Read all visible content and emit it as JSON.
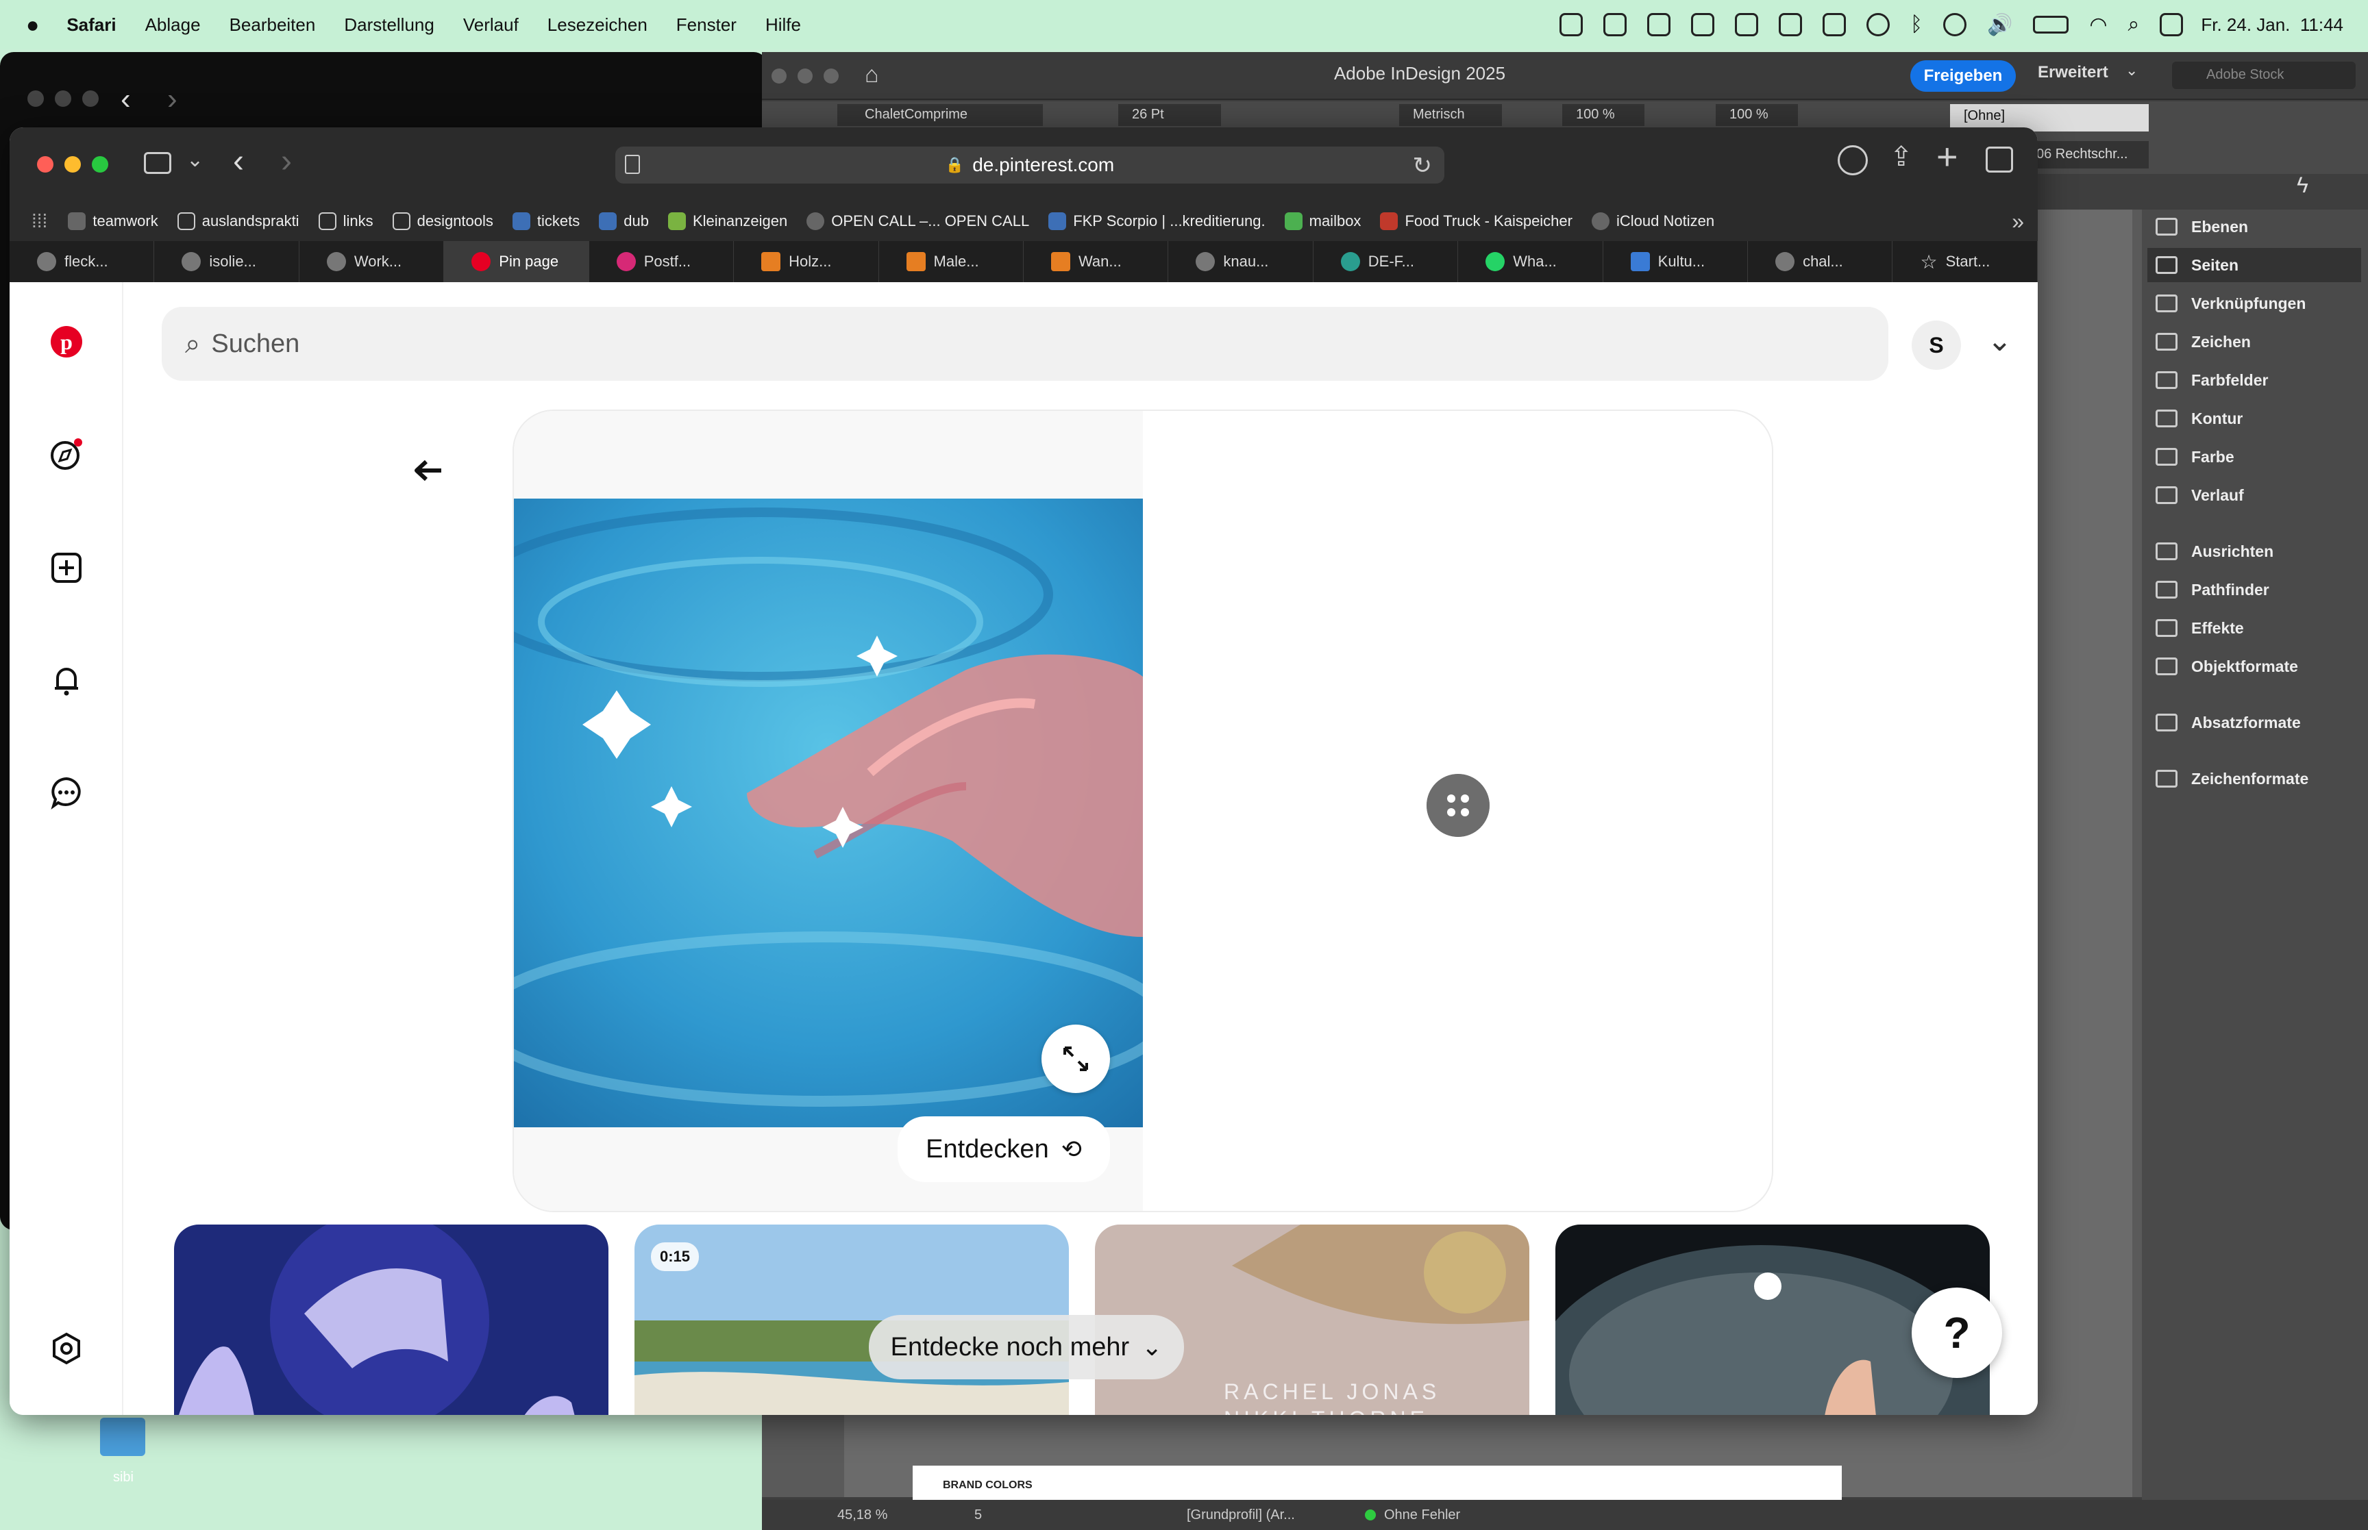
{
  "menubar": {
    "app": "Safari",
    "items": [
      "Ablage",
      "Bearbeiten",
      "Darstellung",
      "Verlauf",
      "Lesezeichen",
      "Fenster",
      "Hilfe"
    ],
    "clock": "Fr. 24. Jan.  11:44"
  },
  "indesign": {
    "title": "Adobe InDesign 2025",
    "share_label": "Freigeben",
    "workspace_label": "Erweitert",
    "stock_placeholder": "Adobe Stock",
    "font_field": "ChaletComprime",
    "size_field": "26 Pt",
    "kerning_field": "Metrisch",
    "scale_v": "100 %",
    "scale_h": "100 %",
    "style_field": "[Ohne]",
    "lang_field": "06 Rechtschr...",
    "panels": [
      "Ebenen",
      "Seiten",
      "Verknüpfungen",
      "Zeichen",
      "Farbfelder",
      "Kontur",
      "Farbe",
      "Verlauf",
      "Ausrichten",
      "Pathfinder",
      "Effekte",
      "Objektformate",
      "Absatzformate",
      "Zeichenformate"
    ],
    "selected_panel": "Seiten",
    "page_text": "BRAND COLORS",
    "status_zoom": "45,18 %",
    "status_page": "5",
    "status_profile": "[Grundprofil] (Ar...",
    "status_errors": "Ohne Fehler"
  },
  "safari": {
    "url": "de.pinterest.com",
    "bookmarks": [
      "teamwork",
      "auslandsprakti",
      "links",
      "designtools",
      "tickets",
      "dub",
      "Kleinanzeigen",
      "OPEN CALL –... OPEN CALL",
      "FKP Scorpio | ...kreditierung.",
      "mailbox",
      "Food Truck - Kaispeicher",
      "iCloud Notizen"
    ],
    "tabs": [
      "fleck...",
      "isolie...",
      "Work...",
      "Pin page",
      "Postf...",
      "Holz...",
      "Male...",
      "Wan...",
      "knau...",
      "DE-F...",
      "Wha...",
      "Kultu...",
      "chal...",
      "Start..."
    ],
    "active_tab": "Pin page"
  },
  "pinterest": {
    "search_placeholder": "Suchen",
    "avatar_letter": "S",
    "entdecken_label": "Entdecken",
    "video_duration": "0:15",
    "more_label": "Entdecke noch mehr",
    "help_label": "?",
    "thumb3_text": "RACHEL JONAS",
    "thumb3_text2": "NIKKI THORNE"
  },
  "desktop": {
    "folder_label": "sibi"
  },
  "colors": {
    "pinterest_red": "#e60023",
    "share_blue": "#1473e6",
    "menubar_bg": "#c6f0d5"
  }
}
